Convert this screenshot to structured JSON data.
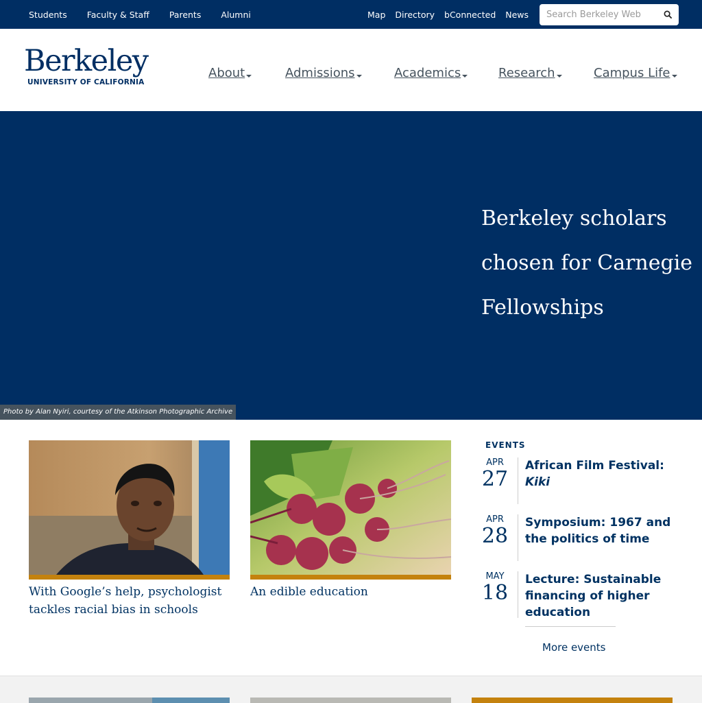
{
  "topbar": {
    "audience_links": [
      "Students",
      "Faculty & Staff",
      "Parents",
      "Alumni"
    ],
    "utility_links": [
      "Map",
      "Directory",
      "bConnected",
      "News"
    ],
    "search_placeholder": "Search Berkeley Web"
  },
  "header": {
    "logo_wordmark": "Berkeley",
    "logo_subtitle": "UNIVERSITY OF CALIFORNIA",
    "nav": [
      "About",
      "Admissions",
      "Academics",
      "Research",
      "Campus Life"
    ]
  },
  "hero": {
    "headline": "Berkeley scholars chosen for Carnegie Fellowships",
    "photo_credit": "Photo by Alan Nyiri, courtesy of the Atkinson Photographic Archive"
  },
  "news": [
    {
      "title": "With Google’s help, psychologist tackles racial bias in schools"
    },
    {
      "title": "An edible education"
    }
  ],
  "events": {
    "heading": "EVENTS",
    "items": [
      {
        "month": "APR",
        "day": "27",
        "title": "African Film Festival:",
        "title_italic": "Kiki"
      },
      {
        "month": "APR",
        "day": "28",
        "title": "Symposium: 1967 and the politics of time",
        "title_italic": ""
      },
      {
        "month": "MAY",
        "day": "18",
        "title": "Lecture: Sustainable financing of higher education",
        "title_italic": ""
      }
    ],
    "more_label": "More events"
  },
  "colors": {
    "berkeley_blue": "#002e63",
    "california_gold": "#c4820e",
    "nav_gray": "#46535e"
  }
}
